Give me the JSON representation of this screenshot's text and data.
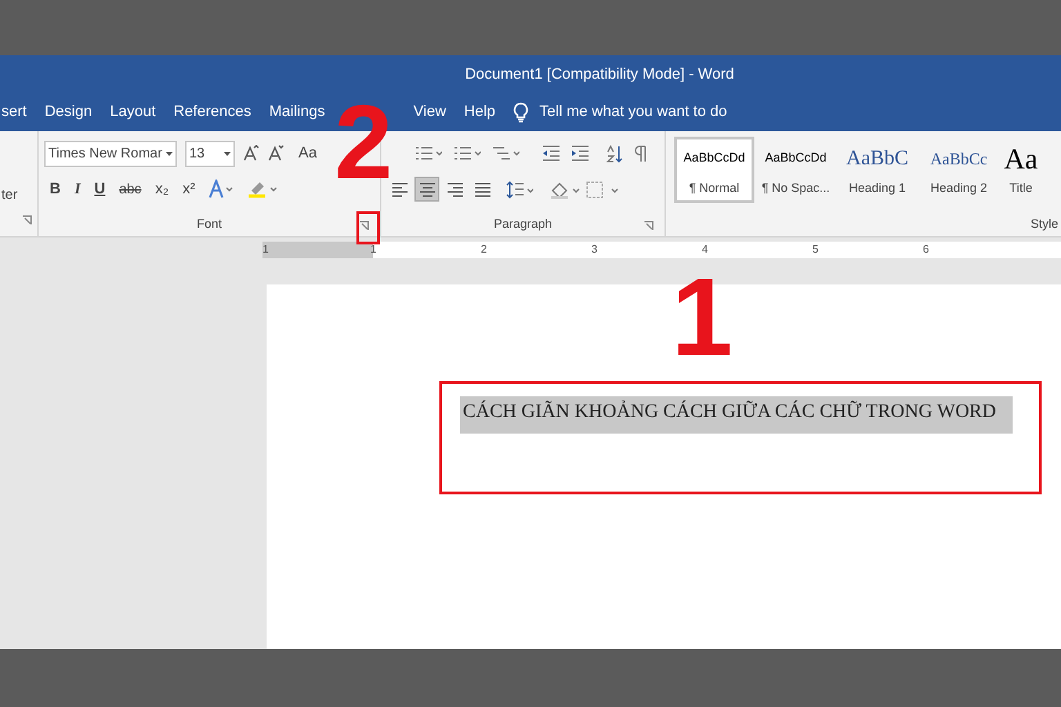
{
  "window": {
    "title": "Document1 [Compatibility Mode]  -  Word"
  },
  "tabs": [
    {
      "label": "sert"
    },
    {
      "label": "Design"
    },
    {
      "label": "Layout"
    },
    {
      "label": "References"
    },
    {
      "label": "Mailings"
    },
    {
      "label": "View"
    },
    {
      "label": "Help"
    }
  ],
  "tell_me": {
    "placeholder": "Tell me what you want to do"
  },
  "clipboard": {
    "label_fragment": "ter"
  },
  "font_group": {
    "font_name": "Times New Romar",
    "font_size": "13",
    "change_case": "Aa",
    "format_buttons": [
      "B",
      "I",
      "U",
      "abc",
      "x₂",
      "x²"
    ],
    "label": "Font"
  },
  "paragraph_group": {
    "label": "Paragraph",
    "alignments": [
      {
        "selected": false
      },
      {
        "selected": true
      },
      {
        "selected": false
      },
      {
        "selected": false
      }
    ]
  },
  "styles": [
    {
      "kind": "body",
      "preview": "AaBbCcDd",
      "name": "¶ Normal",
      "selected": true
    },
    {
      "kind": "body",
      "preview": "AaBbCcDd",
      "name": "¶ No Spac...",
      "selected": false
    },
    {
      "kind": "heading1",
      "preview": "AaBbC",
      "name": "Heading 1",
      "selected": false
    },
    {
      "kind": "heading2",
      "preview": "AaBbCc",
      "name": "Heading 2",
      "selected": false
    },
    {
      "kind": "title",
      "preview": "Aa",
      "name": "Title",
      "selected": false
    }
  ],
  "styles_label": "Style",
  "ruler": {
    "numbers": [
      "1",
      "1",
      "2",
      "3",
      "4",
      "5",
      "6"
    ]
  },
  "document": {
    "heading": "CÁCH GIÃN KHOẢNG CÁCH GIỮA CÁC CHỮ TRONG WORD",
    "selected": true
  },
  "annotations": [
    {
      "label": "2"
    },
    {
      "label": "1"
    }
  ]
}
